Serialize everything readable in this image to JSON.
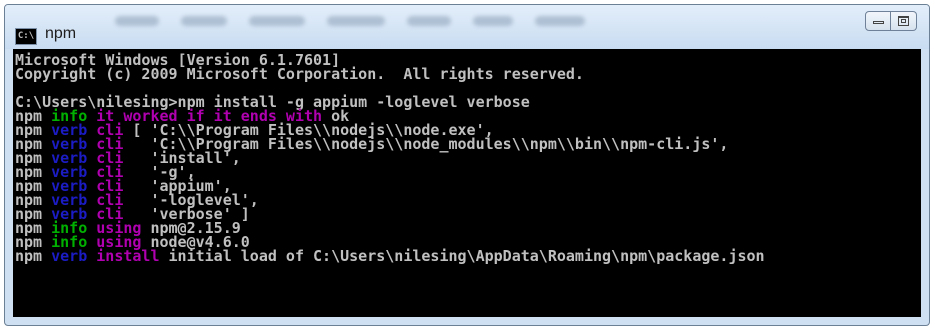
{
  "window": {
    "title": "npm",
    "icon_label": "C:\\",
    "colors": {
      "background": "#000000",
      "default_text": "#c0c0c0",
      "info": "#00b000",
      "verb": "#1c1cc4",
      "message": "#b000b0"
    }
  },
  "console": {
    "lines": [
      [
        {
          "t": "Microsoft Windows [Version 6.1.7601]",
          "c": "white"
        }
      ],
      [
        {
          "t": "Copyright (c) 2009 Microsoft Corporation.  All rights reserved.",
          "c": "white"
        }
      ],
      [
        {
          "t": "",
          "c": "white"
        }
      ],
      [
        {
          "t": "C:\\Users\\nilesing>npm install -g appium -loglevel verbose",
          "c": "white"
        }
      ],
      [
        {
          "t": "npm ",
          "c": "white"
        },
        {
          "t": "info ",
          "c": "green"
        },
        {
          "t": "it worked if it ends with ",
          "c": "magenta"
        },
        {
          "t": "ok",
          "c": "white"
        }
      ],
      [
        {
          "t": "npm ",
          "c": "white"
        },
        {
          "t": "verb ",
          "c": "blue"
        },
        {
          "t": "cli ",
          "c": "magenta"
        },
        {
          "t": "[ 'C:\\\\Program Files\\\\nodejs\\\\node.exe',",
          "c": "white"
        }
      ],
      [
        {
          "t": "npm ",
          "c": "white"
        },
        {
          "t": "verb ",
          "c": "blue"
        },
        {
          "t": "cli ",
          "c": "magenta"
        },
        {
          "t": "  'C:\\\\Program Files\\\\nodejs\\\\node_modules\\\\npm\\\\bin\\\\npm-cli.js',",
          "c": "white"
        }
      ],
      [
        {
          "t": "npm ",
          "c": "white"
        },
        {
          "t": "verb ",
          "c": "blue"
        },
        {
          "t": "cli ",
          "c": "magenta"
        },
        {
          "t": "  'install',",
          "c": "white"
        }
      ],
      [
        {
          "t": "npm ",
          "c": "white"
        },
        {
          "t": "verb ",
          "c": "blue"
        },
        {
          "t": "cli ",
          "c": "magenta"
        },
        {
          "t": "  '-g',",
          "c": "white"
        }
      ],
      [
        {
          "t": "npm ",
          "c": "white"
        },
        {
          "t": "verb ",
          "c": "blue"
        },
        {
          "t": "cli ",
          "c": "magenta"
        },
        {
          "t": "  'appium',",
          "c": "white"
        }
      ],
      [
        {
          "t": "npm ",
          "c": "white"
        },
        {
          "t": "verb ",
          "c": "blue"
        },
        {
          "t": "cli ",
          "c": "magenta"
        },
        {
          "t": "  '-loglevel',",
          "c": "white"
        }
      ],
      [
        {
          "t": "npm ",
          "c": "white"
        },
        {
          "t": "verb ",
          "c": "blue"
        },
        {
          "t": "cli ",
          "c": "magenta"
        },
        {
          "t": "  'verbose' ]",
          "c": "white"
        }
      ],
      [
        {
          "t": "npm ",
          "c": "white"
        },
        {
          "t": "info ",
          "c": "green"
        },
        {
          "t": "using ",
          "c": "magenta"
        },
        {
          "t": "npm@2.15.9",
          "c": "white"
        }
      ],
      [
        {
          "t": "npm ",
          "c": "white"
        },
        {
          "t": "info ",
          "c": "green"
        },
        {
          "t": "using ",
          "c": "magenta"
        },
        {
          "t": "node@v4.6.0",
          "c": "white"
        }
      ],
      [
        {
          "t": "npm ",
          "c": "white"
        },
        {
          "t": "verb ",
          "c": "blue"
        },
        {
          "t": "install ",
          "c": "magenta"
        },
        {
          "t": "initial load of C:\\Users\\nilesing\\AppData\\Roaming\\npm\\package.json",
          "c": "white"
        }
      ]
    ]
  }
}
